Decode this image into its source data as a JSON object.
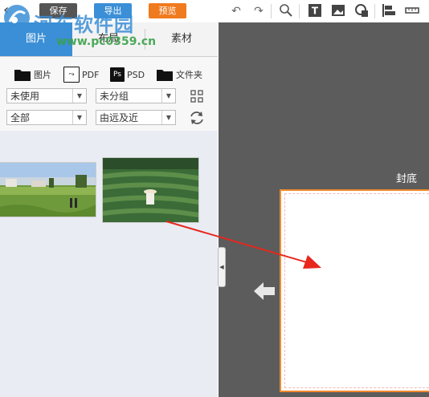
{
  "toolbar": {
    "save_label": "保存",
    "export_label": "导出",
    "preview_label": "预览",
    "colors": {
      "save": "#555555",
      "export": "#3b8fd6",
      "preview": "#f07a1e"
    },
    "icons": [
      "undo-icon",
      "redo-icon",
      "zoom-icon",
      "text-icon",
      "image-icon",
      "shape-icon",
      "align-icon",
      "ruler-icon"
    ]
  },
  "tabs": [
    {
      "label": "图片",
      "active": true
    },
    {
      "label": "布局",
      "active": false
    },
    {
      "label": "素材",
      "active": false
    }
  ],
  "file_types": [
    {
      "label": "图片",
      "icon": "folder-icon"
    },
    {
      "label": "PDF",
      "icon": "pdf-icon"
    },
    {
      "label": "PSD",
      "icon": "psd-icon"
    },
    {
      "label": "文件夹",
      "icon": "folder-icon"
    }
  ],
  "filters": {
    "usage": "未使用",
    "group": "未分组",
    "scope": "全部",
    "sort": "由远及近"
  },
  "canvas": {
    "page_label": "封底",
    "accent": "#f08a2c"
  },
  "watermark": {
    "site_name": "河东软件园",
    "url": "www.pc0359.cn"
  }
}
